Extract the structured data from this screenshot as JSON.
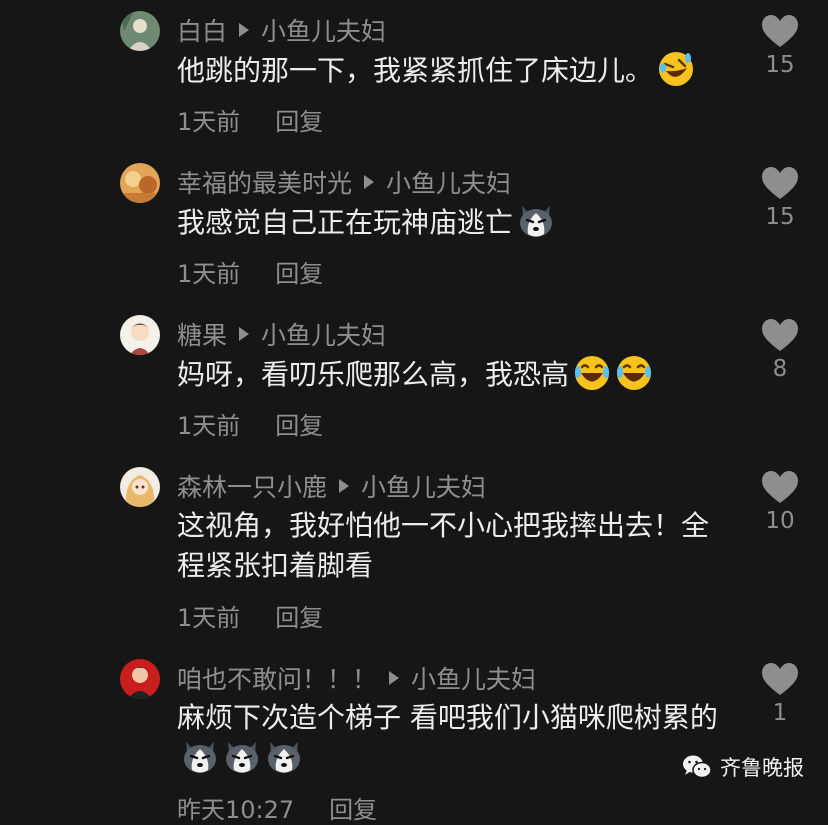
{
  "comments": [
    {
      "author": "白白",
      "reply_to": "小鱼儿夫妇",
      "text": "他跳的那一下，我紧紧抓住了床边儿。",
      "emojis": [
        "rofl-emoji"
      ],
      "time": "1天前",
      "reply_label": "回复",
      "likes": "15"
    },
    {
      "author": "幸福的最美时光",
      "reply_to": "小鱼儿夫妇",
      "text": "我感觉自己正在玩神庙逃亡",
      "emojis": [
        "husky-emoji"
      ],
      "time": "1天前",
      "reply_label": "回复",
      "likes": "15"
    },
    {
      "author": "糖果",
      "reply_to": "小鱼儿夫妇",
      "text": "妈呀，看叨乐爬那么高，我恐高",
      "emojis": [
        "laugh-cry-emoji",
        "laugh-cry-emoji"
      ],
      "time": "1天前",
      "reply_label": "回复",
      "likes": "8"
    },
    {
      "author": "森林一只小鹿",
      "reply_to": "小鱼儿夫妇",
      "text": "这视角，我好怕他一不小心把我摔出去！全程紧张扣着脚看",
      "emojis": [],
      "time": "1天前",
      "reply_label": "回复",
      "likes": "10"
    },
    {
      "author": "咱也不敢问！！！",
      "reply_to": "小鱼儿夫妇",
      "text": "麻烦下次造个梯子 看吧我们小猫咪爬树累的",
      "emojis": [
        "husky-emoji",
        "husky-emoji",
        "husky-emoji"
      ],
      "time": "昨天10:27",
      "reply_label": "回复",
      "likes": "1"
    }
  ],
  "watermark": {
    "text": "齐鲁晚报",
    "icon": "wechat-icon"
  },
  "colors": {
    "background": "#161616",
    "text_primary": "#ececec",
    "text_secondary": "#8e8e8e",
    "like_icon": "#8e8e8e"
  }
}
